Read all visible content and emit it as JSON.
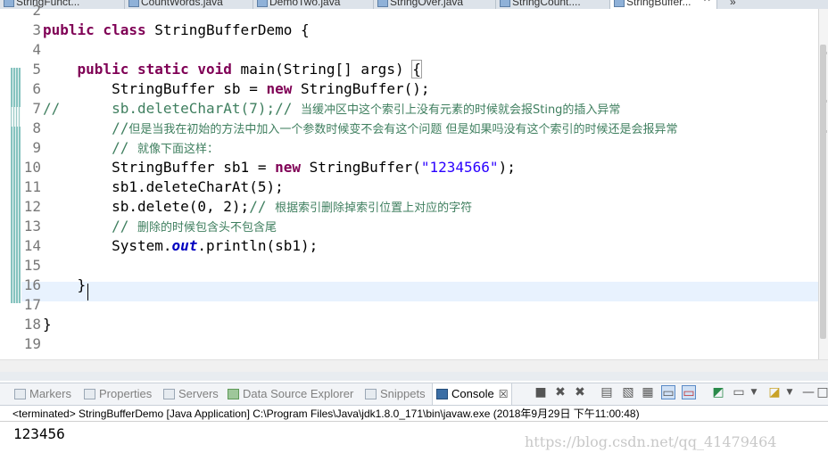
{
  "editor_tabs": [
    {
      "label": "StringFunct..."
    },
    {
      "label": "CountWords.java"
    },
    {
      "label": "DemoTwo.java"
    },
    {
      "label": "StringOver.java"
    },
    {
      "label": "StringCount...."
    },
    {
      "label": "StringBuffer...",
      "close": "✕"
    },
    {
      "label": "»"
    }
  ],
  "code_lines": [
    {
      "n": "2",
      "parts": []
    },
    {
      "n": "3",
      "parts": [
        {
          "t": "public class",
          "c": "kw"
        },
        {
          "t": " StringBufferDemo {",
          "c": ""
        }
      ]
    },
    {
      "n": "4",
      "parts": []
    },
    {
      "n": "5",
      "parts": [
        {
          "t": "    ",
          "c": ""
        },
        {
          "t": "public static void",
          "c": "kw"
        },
        {
          "t": " main(String[] args) ",
          "c": ""
        },
        {
          "t": "{",
          "c": "brace-box"
        }
      ]
    },
    {
      "n": "6",
      "parts": [
        {
          "t": "        StringBuffer sb = ",
          "c": ""
        },
        {
          "t": "new",
          "c": "kw"
        },
        {
          "t": " StringBuffer();",
          "c": ""
        }
      ]
    },
    {
      "n": "7",
      "parts": [
        {
          "t": "//      sb.deleteCharAt(7);// ",
          "c": "cm"
        },
        {
          "t": "当缓冲区中这个索引上没有元素的时候就会报Sting的插入异常",
          "c": "cm cjk"
        }
      ]
    },
    {
      "n": "8",
      "parts": [
        {
          "t": "        //",
          "c": "cm"
        },
        {
          "t": "但是当我在初始的方法中加入一个参数时候变不会有这个问题 但是如果吗没有这个索引的时候还是会报异常",
          "c": "cm cjk"
        }
      ]
    },
    {
      "n": "9",
      "parts": [
        {
          "t": "        // ",
          "c": "cm"
        },
        {
          "t": "就像下面这样：",
          "c": "cm cjk"
        }
      ]
    },
    {
      "n": "10",
      "parts": [
        {
          "t": "        StringBuffer sb1 = ",
          "c": ""
        },
        {
          "t": "new",
          "c": "kw"
        },
        {
          "t": " StringBuffer(",
          "c": ""
        },
        {
          "t": "\"1234566\"",
          "c": "str"
        },
        {
          "t": ");",
          "c": ""
        }
      ]
    },
    {
      "n": "11",
      "parts": [
        {
          "t": "        sb1.deleteCharAt(5);",
          "c": ""
        }
      ]
    },
    {
      "n": "12",
      "parts": [
        {
          "t": "        sb.delete(0, 2);",
          "c": ""
        },
        {
          "t": "// ",
          "c": "cm"
        },
        {
          "t": "根据索引删除掉索引位置上对应的字符",
          "c": "cm cjk"
        }
      ]
    },
    {
      "n": "13",
      "parts": [
        {
          "t": "        // ",
          "c": "cm"
        },
        {
          "t": "删除的时候包含头不包含尾",
          "c": "cm cjk"
        }
      ]
    },
    {
      "n": "14",
      "parts": [
        {
          "t": "        System.",
          "c": ""
        },
        {
          "t": "out",
          "c": "fld"
        },
        {
          "t": ".println(sb1);",
          "c": ""
        }
      ]
    },
    {
      "n": "15",
      "parts": []
    },
    {
      "n": "16",
      "parts": [
        {
          "t": "    }",
          "c": ""
        }
      ]
    },
    {
      "n": "17",
      "parts": []
    },
    {
      "n": "18",
      "parts": [
        {
          "t": "}",
          "c": ""
        }
      ]
    },
    {
      "n": "19",
      "parts": []
    }
  ],
  "views": {
    "markers": "Markers",
    "properties": "Properties",
    "servers": "Servers",
    "data_source_explorer": "Data Source Explorer",
    "snippets": "Snippets",
    "console": "Console",
    "console_close": "☒"
  },
  "toolbar_icons": [
    "stop-icon",
    "remove-launch-icon",
    "remove-all-terminated-icon",
    "clear-console-icon",
    "scroll-lock-icon",
    "word-wrap-icon",
    "show-on-stdout-icon",
    "show-on-stderr-icon",
    "pin-console-icon",
    "display-console-icon",
    "dropdown-icon",
    "new-console-icon",
    "dropdown-icon",
    "minimize-icon",
    "maximize-icon"
  ],
  "console": {
    "status": "<terminated> StringBufferDemo [Java Application] C:\\Program Files\\Java\\jdk1.8.0_171\\bin\\javaw.exe (2018年9月29日 下午11:00:48)",
    "output": "123456",
    "watermark": "https://blog.csdn.net/qq_41479464"
  }
}
